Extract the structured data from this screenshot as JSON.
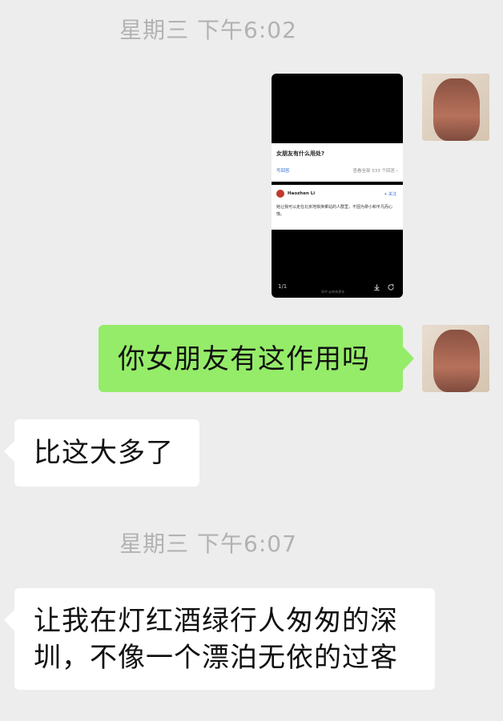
{
  "timestamps": [
    "星期三 下午6:02",
    "星期三 下午6:07"
  ],
  "shared_image": {
    "question": "女朋友有什么用处?",
    "write_answer": "写回答",
    "view_all": "查看全部 533 个回答 ›",
    "answerer": "Haozhen Li",
    "follow": "+ 关注",
    "answer_text": "她让我可以走在北京地铁换乘站的人群里，不因为渺小和平凡而心慌。",
    "page_indicator": "1/1",
    "watermark": "知乎 @匆匆那年"
  },
  "messages": {
    "outgoing": "你女朋友有这作用吗",
    "incoming1": "比这大多了",
    "incoming2_line1": "让我在灯红酒绿行人匆匆的深",
    "incoming2_line2": "圳，不像一个漂泊无依的过客"
  },
  "colors": {
    "background": "#ededed",
    "outgoing_bubble": "#95ec69",
    "incoming_bubble": "#ffffff",
    "timestamp_text": "#b2b2b2"
  },
  "icons": [
    "avatar",
    "download-icon",
    "share-icon"
  ]
}
